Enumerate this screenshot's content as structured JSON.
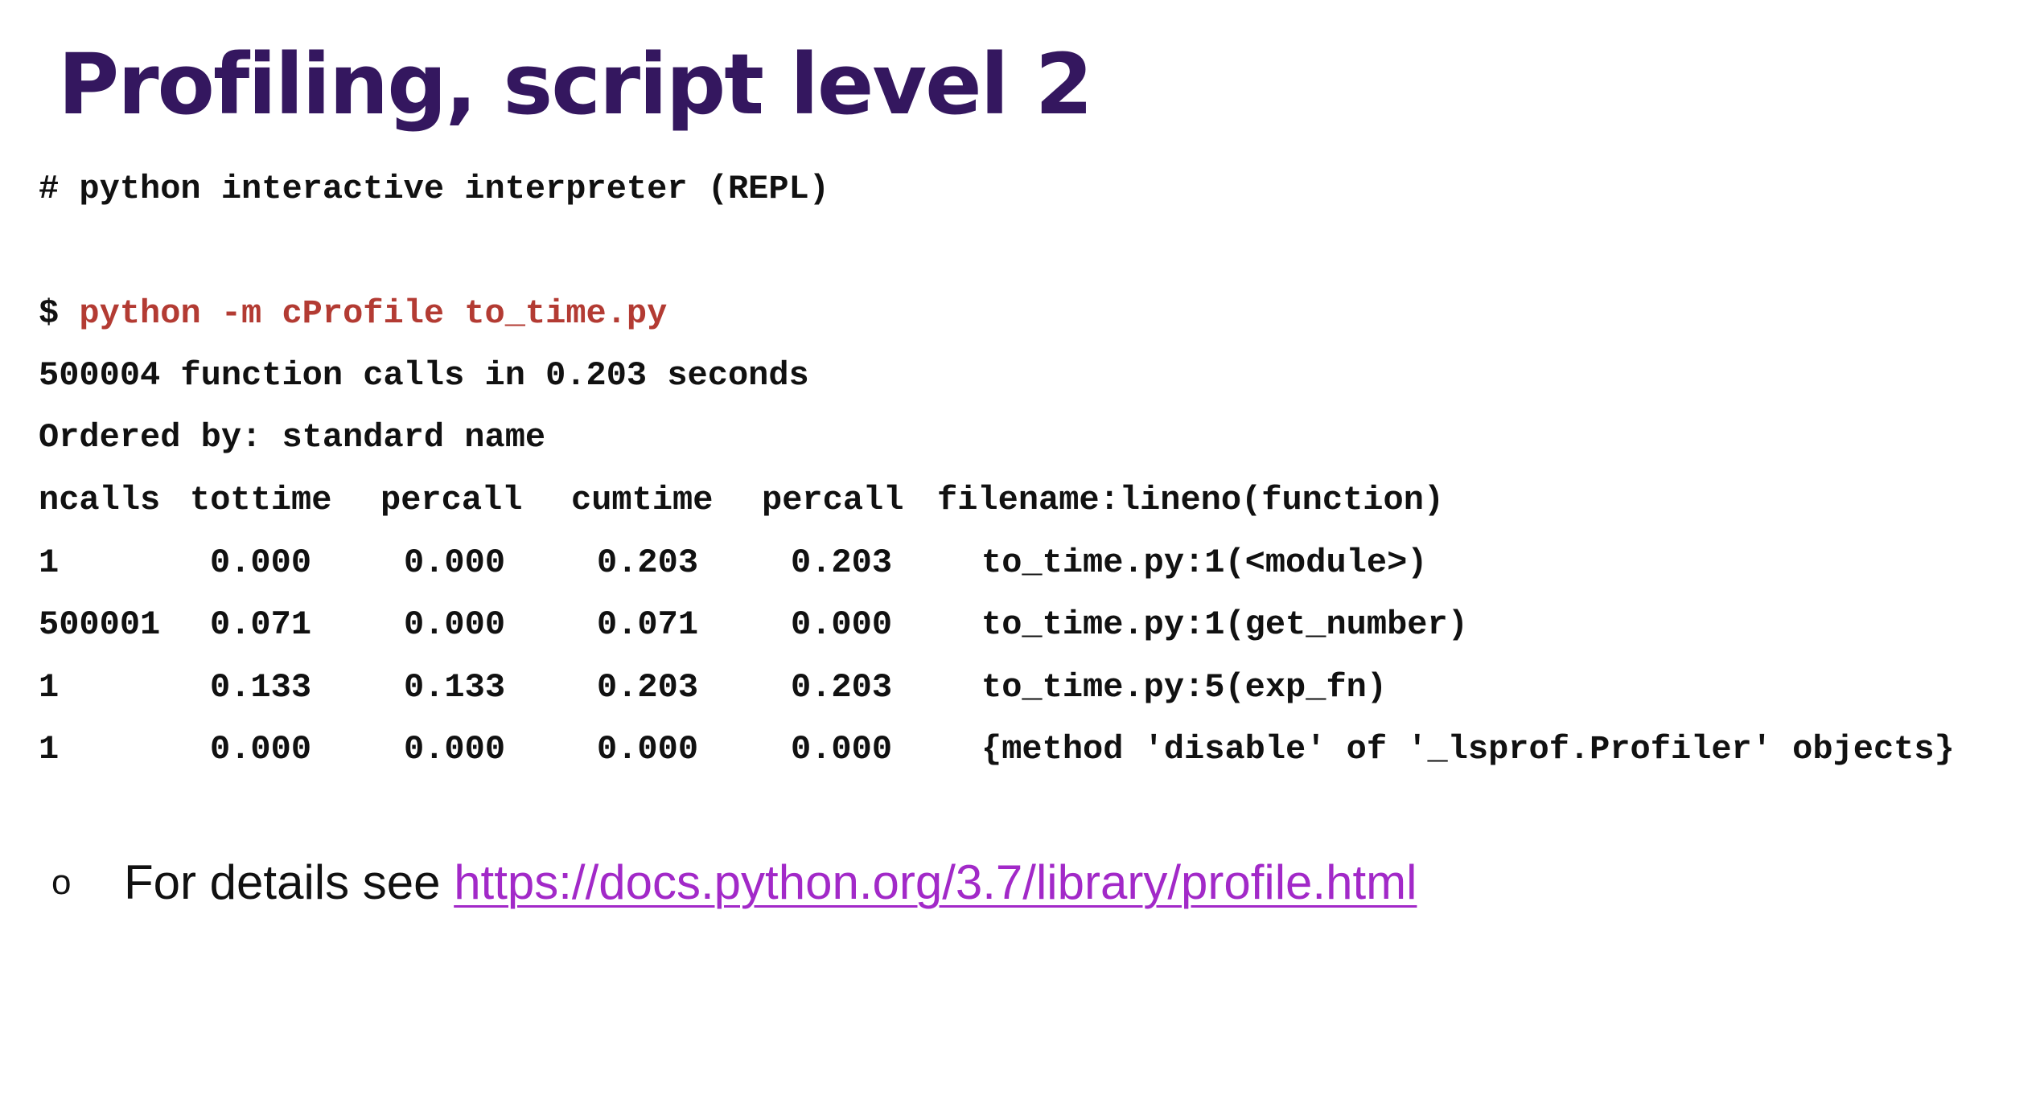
{
  "slide": {
    "title": "Profiling, script level 2"
  },
  "code": {
    "comment": "# python interactive interpreter (REPL)",
    "prompt": "$ ",
    "command": "python -m cProfile to_time.py",
    "summary": "500004 function calls in 0.203 seconds",
    "ordered_by": "Ordered by: standard name",
    "columns": [
      "ncalls",
      "tottime",
      "percall",
      "cumtime",
      "percall",
      "filename:lineno(function)"
    ],
    "rows": [
      [
        "1",
        "0.000",
        "0.000",
        "0.203",
        "0.203",
        "to_time.py:1(<module>)"
      ],
      [
        "500001",
        "0.071",
        "0.000",
        "0.071",
        "0.000",
        "to_time.py:1(get_number)"
      ],
      [
        "1",
        "0.133",
        "0.133",
        "0.203",
        "0.203",
        "to_time.py:5(exp_fn)"
      ],
      [
        "1",
        "0.000",
        "0.000",
        "0.000",
        "0.000",
        "{method 'disable' of '_lsprof.Profiler' objects}"
      ]
    ]
  },
  "bullet": {
    "marker": "o",
    "text": "For details see ",
    "link_text": "https://docs.python.org/3.7/library/profile.html"
  },
  "colors": {
    "title": "#34175f",
    "command": "#b33b33",
    "link": "#a229c8",
    "text": "#111111"
  }
}
